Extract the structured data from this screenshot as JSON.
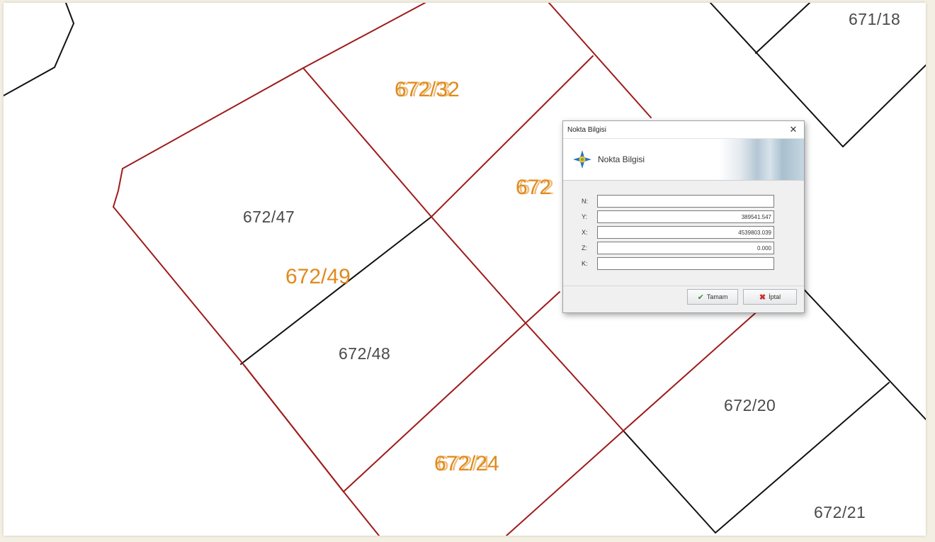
{
  "map": {
    "parcels": [
      {
        "id": "p1",
        "text": "671/18",
        "style": "gray"
      },
      {
        "id": "p2",
        "text": "672/47",
        "style": "gray"
      },
      {
        "id": "p3",
        "text": "672/48",
        "style": "gray"
      },
      {
        "id": "p4",
        "text": "672/20",
        "style": "gray"
      },
      {
        "id": "p5",
        "text": "672/21",
        "style": "gray"
      },
      {
        "id": "p6",
        "text": "672/49",
        "style": "orange"
      }
    ],
    "overlapping_labels": [
      {
        "id": "o1",
        "front": "672/32",
        "ghost": "672/3"
      },
      {
        "id": "o2",
        "front": "672",
        "ghost": "672"
      },
      {
        "id": "o3",
        "front": "672/24",
        "ghost": "672/4"
      }
    ],
    "colors": {
      "boundary_red": "#9e1b1b",
      "boundary_black": "#111111",
      "label_orange": "#e08a1c",
      "label_gray": "#4a4a4a"
    }
  },
  "dialog": {
    "window_title": "Nokta Bilgisi",
    "close_icon": "close-icon",
    "banner_title": "Nokta Bilgisi",
    "banner_icon": "compass-icon",
    "fields": [
      {
        "label": "N:",
        "value": ""
      },
      {
        "label": "Y:",
        "value": "389541.547"
      },
      {
        "label": "X:",
        "value": "4539803.039"
      },
      {
        "label": "Z:",
        "value": "0.000"
      },
      {
        "label": "K:",
        "value": ""
      }
    ],
    "ok_label": "Tamam",
    "cancel_label": "İptal"
  }
}
